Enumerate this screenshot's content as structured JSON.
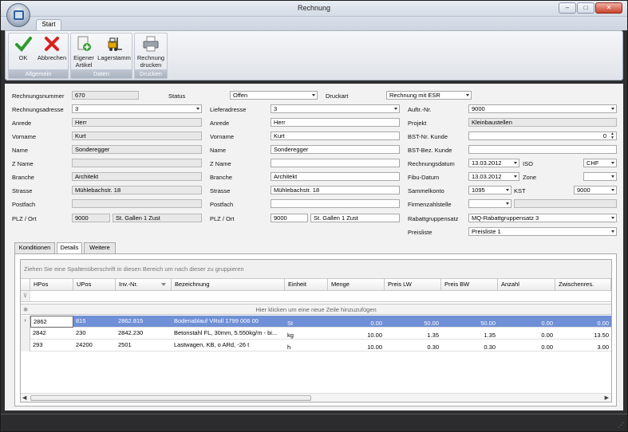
{
  "window": {
    "title": "Rechnung",
    "min": "–",
    "max": "□",
    "close": "✕"
  },
  "ribbon": {
    "tab": "Start",
    "groups": [
      {
        "label": "Allgemein",
        "buttons": [
          {
            "l1": "OK",
            "l2": ""
          },
          {
            "l1": "Abbrechen",
            "l2": ""
          }
        ]
      },
      {
        "label": "Daten",
        "buttons": [
          {
            "l1": "Eigener",
            "l2": "Artikel"
          },
          {
            "l1": "Lagerstamm",
            "l2": ""
          }
        ]
      },
      {
        "label": "Drucken",
        "buttons": [
          {
            "l1": "Rechnung",
            "l2": "drucken"
          }
        ]
      }
    ]
  },
  "form": {
    "col1": {
      "rechnungsnummer": {
        "label": "Rechnungsnummer",
        "value": "670"
      },
      "rechnungsadresse": {
        "label": "Rechnungsadresse",
        "value": "3"
      },
      "anrede": {
        "label": "Anrede",
        "value": "Herr"
      },
      "vorname": {
        "label": "Vorname",
        "value": "Kurt"
      },
      "name": {
        "label": "Name",
        "value": "Sonderegger"
      },
      "zname": {
        "label": "Z Name",
        "value": ""
      },
      "branche": {
        "label": "Branche",
        "value": "Architekt"
      },
      "strasse": {
        "label": "Strasse",
        "value": "Mühlebachstr. 18"
      },
      "postfach": {
        "label": "Postfach",
        "value": ""
      },
      "plzort": {
        "label": "PLZ / Ort",
        "plz": "9000",
        "ort": "St. Gallen 1 Zust"
      }
    },
    "status": {
      "label": "Status",
      "value": "Offen"
    },
    "druckart": {
      "label": "Druckart",
      "value": "Rechnung mit ESR"
    },
    "col2": {
      "lieferadresse": {
        "label": "Lieferadresse",
        "value": "3"
      },
      "anrede": {
        "label": "Anrede",
        "value": "Herr"
      },
      "vorname": {
        "label": "Vorname",
        "value": "Kurt"
      },
      "name": {
        "label": "Name",
        "value": "Sonderegger"
      },
      "zname": {
        "label": "Z Name",
        "value": ""
      },
      "branche": {
        "label": "Branche",
        "value": "Architekt"
      },
      "strasse": {
        "label": "Strasse",
        "value": "Mühlebachstr. 18"
      },
      "postfach": {
        "label": "Postfach",
        "value": ""
      },
      "plzort": {
        "label": "PLZ / Ort",
        "plz": "9000",
        "ort": "St. Gallen 1 Zust"
      }
    },
    "col3": {
      "auftrnr": {
        "label": "Auftr.-Nr.",
        "value": "9000"
      },
      "projekt": {
        "label": "Projekt",
        "value": "Kleinbaustellen"
      },
      "bstnr": {
        "label": "BST-Nr. Kunde",
        "value": "0"
      },
      "bstbez": {
        "label": "BST-Bez. Kunde",
        "value": ""
      },
      "rechnungsdatum": {
        "label": "Rechnungsdatum",
        "value": "13.03.2012"
      },
      "iso": {
        "label": "ISO",
        "value": "CHF"
      },
      "fibudatum": {
        "label": "Fibu-Datum",
        "value": "13.03.2012"
      },
      "zone": {
        "label": "Zone",
        "value": ""
      },
      "sammelkonto": {
        "label": "Sammelkonto",
        "value": "1095"
      },
      "kst": {
        "label": "KST",
        "value": "9000"
      },
      "firmenzahlstelle": {
        "label": "Firmenzahlstelle",
        "value": "",
        "value2": ""
      },
      "rabattgruppensatz": {
        "label": "Rabattgruppensatz",
        "value": "MQ-Rabattgruppensatz  3"
      },
      "preisliste": {
        "label": "Preisliste",
        "value": "Preisliste 1"
      }
    }
  },
  "tabs": [
    "Konditionen",
    "Details",
    "Weitere"
  ],
  "grid": {
    "group_hint": "Ziehen Sie eine Spaltenüberschrift in diesen Bereich um nach dieser zu gruppieren",
    "new_row_hint": "Hier klicken um eine neue Zeile hinzuzufügen",
    "columns": [
      "HPos",
      "UPos",
      "Inv.-Nr.",
      "Bezeichnung",
      "Einheit",
      "Menge",
      "Preis LW",
      "Preis BW",
      "Anzahl",
      "Zwischenres."
    ],
    "rows": [
      [
        "2862",
        "815",
        "2862.815",
        "Bodenablauf VRoll 1799 006 00",
        "St",
        "0.00",
        "50.00",
        "50.00",
        "0.00",
        "0.00"
      ],
      [
        "2842",
        "230",
        "2842.230",
        "Betonstahl FL, 30mm, 5.550kg/m - bi...",
        "kg",
        "10.00",
        "1.35",
        "1.35",
        "0.00",
        "13.50"
      ],
      [
        "293",
        "24200",
        "2501",
        "Lastwagen, KB, o ARd, -26 t",
        "h",
        "10.00",
        "0.30",
        "0.30",
        "0.00",
        "3.00"
      ]
    ]
  }
}
